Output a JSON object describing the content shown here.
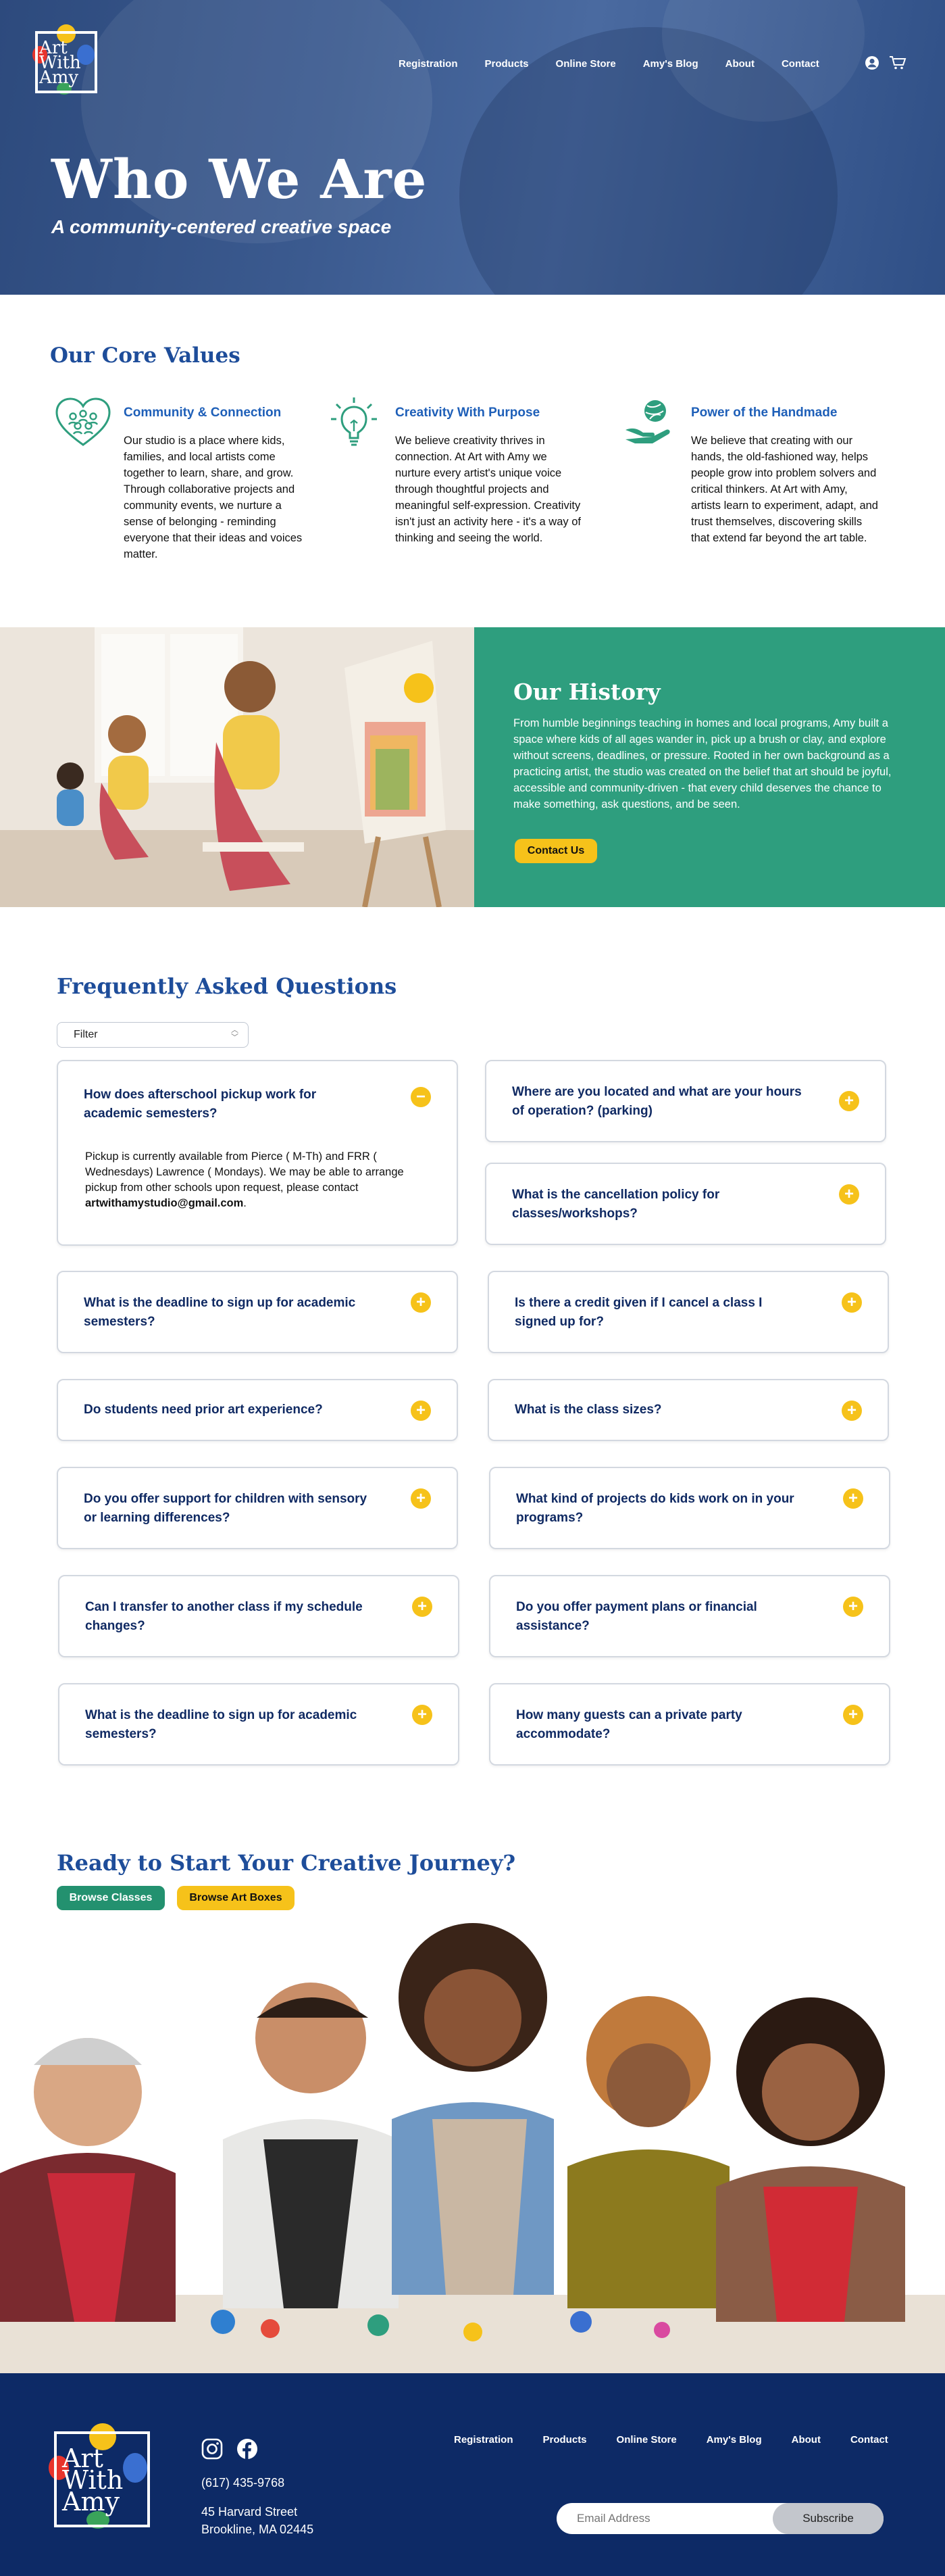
{
  "header": {
    "logo_text": [
      "Art",
      "With",
      "Amy"
    ],
    "nav": [
      "Registration",
      "Products",
      "Online Store",
      "Amy's Blog",
      "About",
      "Contact"
    ],
    "icons": [
      "account-icon",
      "cart-icon"
    ]
  },
  "hero": {
    "title": "Who We Are",
    "subtitle": "A community-centered creative space"
  },
  "core_values": {
    "title": "Our Core Values",
    "items": [
      {
        "icon": "community-heart-icon",
        "title": "Community & Connection",
        "text": "Our studio is a place where kids, families, and local artists come together to learn, share, and grow. Through collaborative projects and community events, we nurture a sense of belonging - reminding everyone that their ideas and voices matter."
      },
      {
        "icon": "lightbulb-icon",
        "title": "Creativity With Purpose",
        "text": "We believe creativity thrives in connection. At Art with Amy we nurture every artist's unique voice through thoughtful projects and meaningful self-expression. Creativity isn't just an activity here - it's a way of thinking and seeing the world."
      },
      {
        "icon": "hand-globe-icon",
        "title": "Power of the Handmade",
        "text": "We believe that creating with our hands, the old-fashioned way, helps people grow into problem solvers and critical thinkers. At Art with Amy, artists learn to experiment, adapt, and trust themselves, discovering skills that extend far beyond the art table."
      }
    ]
  },
  "history": {
    "title": "Our History",
    "text": "From humble beginnings teaching in homes and local programs, Amy built a space where kids of all ages wander in, pick up a brush or clay, and explore without screens, deadlines, or pressure. Rooted in her own background as a practicing artist, the studio was created on the belief that art should be joyful, accessible and community-driven - that every child deserves the chance to make something, ask questions, and be seen.",
    "button": "Contact Us"
  },
  "faq": {
    "title": "Frequently Asked Questions",
    "filter_placeholder": "Filter",
    "open_question": "How does afterschool pickup work for academic semesters?",
    "open_answer": "Pickup is currently available from Pierce ( M-Th) and FRR ( Wednesdays) Lawrence ( Mondays). We may be able to arrange pickup from other schools upon request, please contact ",
    "open_email": "artwithamystudio@gmail.com",
    "questions": [
      "Where are you located and what are your hours of operation? (parking)",
      "What is the cancellation policy for classes/workshops?",
      "What is the deadline to sign up for academic semesters?",
      "Is there a credit given if I cancel a class I signed up for?",
      "Do students need prior art experience?",
      "What is the class sizes?",
      "Do you offer support for children with sensory or learning differences?",
      "What kind of projects do kids work on in your programs?",
      "Can I transfer to another class if my schedule changes?",
      "Do you offer payment plans or financial assistance?",
      "What is the deadline to sign up for academic semesters?",
      "How many guests can a private party accommodate?"
    ]
  },
  "cta": {
    "title": "Ready to Start Your Creative Journey?",
    "buttons": [
      "Browse Classes",
      "Browse Art Boxes"
    ]
  },
  "footer": {
    "phone": "(617) 435-9768",
    "address_line1": "45 Harvard Street",
    "address_line2": "Brookline, MA 02445",
    "nav": [
      "Registration",
      "Products",
      "Online Store",
      "Amy's Blog",
      "About",
      "Contact"
    ],
    "email_placeholder": "Email Address",
    "subscribe": "Subscribe",
    "social": [
      "instagram-icon",
      "facebook-icon"
    ]
  },
  "colors": {
    "navy": "#0d2a66",
    "blue_heading": "#1e4d9a",
    "teal": "#2e9e7e",
    "green_button": "#23916f",
    "yellow": "#f6c21a"
  }
}
